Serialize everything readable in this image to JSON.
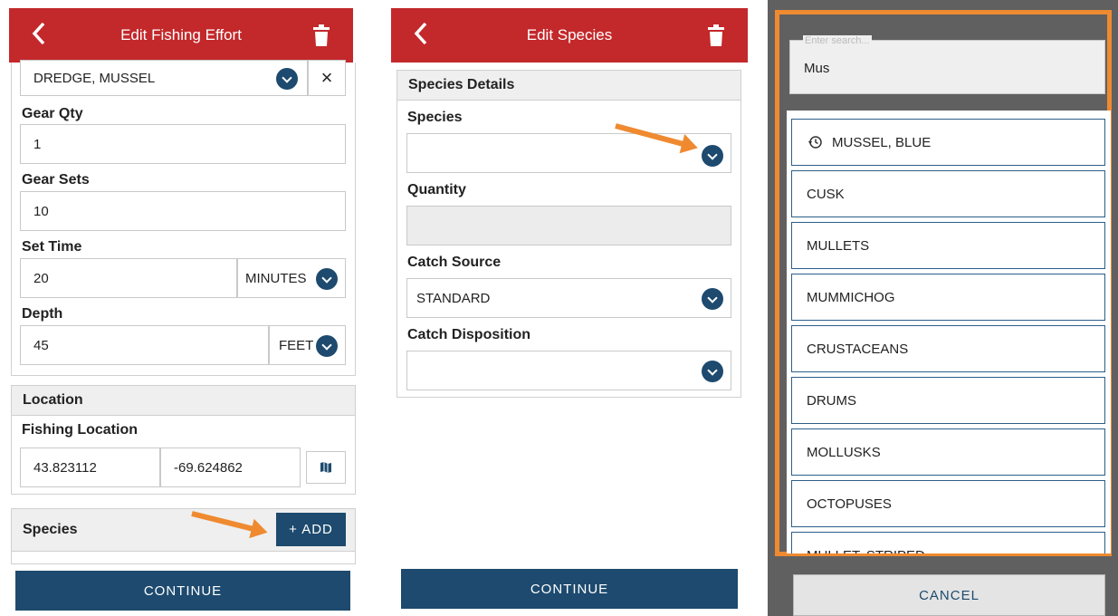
{
  "s1": {
    "title": "Edit Fishing Effort",
    "gear": "DREDGE, MUSSEL",
    "gear_clear": "×",
    "gear_qty_label": "Gear Qty",
    "gear_qty": "1",
    "gear_sets_label": "Gear Sets",
    "gear_sets": "10",
    "set_time_label": "Set Time",
    "set_time": "20",
    "set_time_unit": "MINUTES",
    "depth_label": "Depth",
    "depth": "45",
    "depth_unit": "FEET",
    "location_header": "Location",
    "fishing_location_label": "Fishing Location",
    "lat": "43.823112",
    "lon": "-69.624862",
    "species_header": "Species",
    "add_label": "+ ADD",
    "continue_label": "CONTINUE"
  },
  "s2": {
    "title": "Edit Species",
    "details_header": "Species Details",
    "species_label": "Species",
    "species_value": "",
    "quantity_label": "Quantity",
    "quantity_value": "",
    "catch_source_label": "Catch Source",
    "catch_source": "STANDARD",
    "catch_disposition_label": "Catch Disposition",
    "catch_disposition": "",
    "continue_label": "CONTINUE"
  },
  "s3": {
    "search_placeholder": "Enter search...",
    "search_value": "Mus",
    "items": [
      "MUSSEL, BLUE",
      "CUSK",
      "MULLETS",
      "MUMMICHOG",
      "CRUSTACEANS",
      "DRUMS",
      "MOLLUSKS",
      "OCTOPUSES",
      "MULLET, STRIPED"
    ],
    "cancel_label": "CANCEL"
  },
  "colors": {
    "header": "#c3282b",
    "primary": "#1d4a6e",
    "highlight": "#ef8a30"
  }
}
